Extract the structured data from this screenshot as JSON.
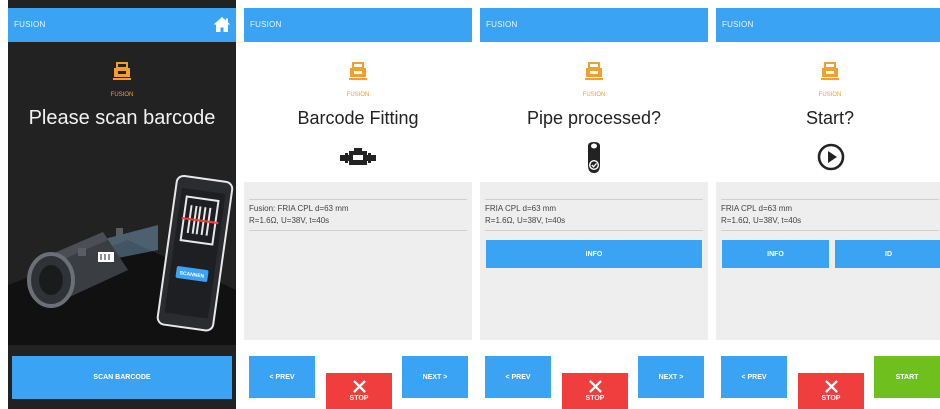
{
  "app_title": "FUSION",
  "logo_label": "FUSION",
  "colors": {
    "appbar": "#3aa3f3",
    "accent_orange": "#f0a030",
    "button_blue": "#3aa3f3",
    "stop_red": "#f03e3e",
    "start_green": "#6fbf1d",
    "dark_bg": "#222222"
  },
  "screen1": {
    "heading": "Please scan barcode",
    "illustration_button": "SCANNEN",
    "scan_button": "SCAN BARCODE",
    "home_icon": "home-icon"
  },
  "screen2": {
    "heading": "Barcode Fitting",
    "icon": "fitting-icon",
    "line1": "Fusion: FRIA CPL d=63 mm",
    "line2": "R=1.6Ω, U=38V, t=40s",
    "prev": "< PREV",
    "stop": "STOP",
    "next": "NEXT >"
  },
  "screen3": {
    "heading": "Pipe processed?",
    "icon": "pipe-check-icon",
    "line1": "FRIA CPL d=63 mm",
    "line2": "R=1.6Ω, U=38V, t=40s",
    "info": "INFO",
    "prev": "< PREV",
    "stop": "STOP",
    "next": "NEXT >"
  },
  "screen4": {
    "heading": "Start?",
    "icon": "play-circle-icon",
    "line1": "FRIA CPL d=63 mm",
    "line2": "R=1.6Ω, U=38V, t=40s",
    "info": "INFO",
    "id": "ID",
    "prev": "< PREV",
    "stop": "STOP",
    "start": "START"
  }
}
